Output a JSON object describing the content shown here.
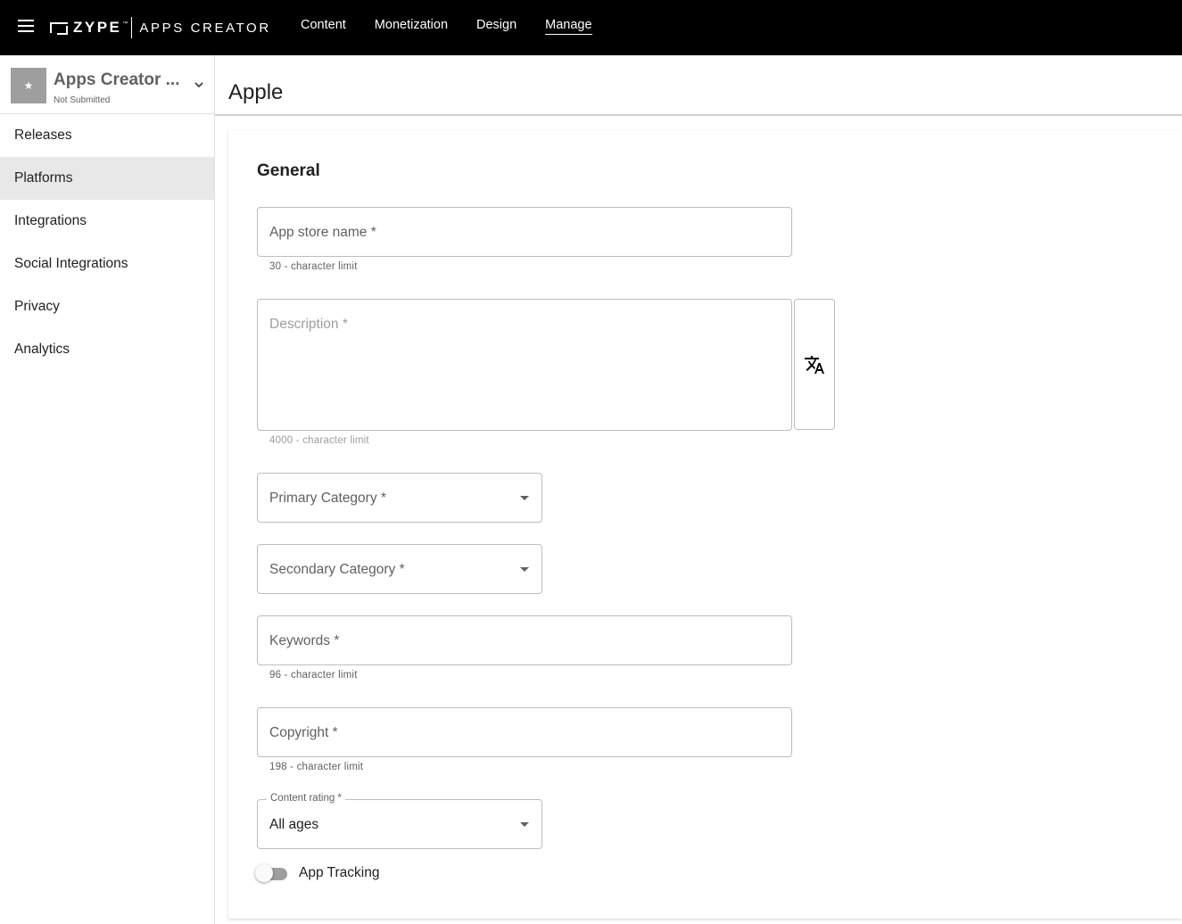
{
  "topbar": {
    "logo_brand": "ZYPE",
    "logo_tm": "™",
    "logo_product": "APPS CREATOR",
    "nav": [
      "Content",
      "Monetization",
      "Design",
      "Manage"
    ],
    "active_nav": "Manage"
  },
  "sidebar": {
    "app_name": "Apps Creator ...",
    "app_status": "Not Submitted",
    "app_thumb_glyph": "★",
    "items": [
      {
        "label": "Releases"
      },
      {
        "label": "Platforms"
      },
      {
        "label": "Integrations"
      },
      {
        "label": "Social Integrations"
      },
      {
        "label": "Privacy"
      },
      {
        "label": "Analytics"
      }
    ],
    "active_item": "Platforms"
  },
  "page": {
    "title": "Apple",
    "section_title": "General"
  },
  "form": {
    "app_store_name": {
      "placeholder": "App store name *",
      "hint": "30 - character limit"
    },
    "description": {
      "placeholder": "Description *",
      "hint": "4000 - character limit"
    },
    "primary_category": {
      "placeholder": "Primary Category *"
    },
    "secondary_category": {
      "placeholder": "Secondary Category *"
    },
    "keywords": {
      "placeholder": "Keywords *",
      "hint": "96 - character limit"
    },
    "copyright": {
      "placeholder": "Copyright *",
      "hint": "198 - character limit"
    },
    "content_rating": {
      "label": "Content rating *",
      "value": "All ages"
    },
    "app_tracking": {
      "label": "App Tracking",
      "enabled": false
    }
  },
  "icons": {
    "menu": "hamburger-menu-icon",
    "chevron": "chevron-down-icon",
    "translate": "translate-icon",
    "dropdown": "dropdown-arrow-icon"
  }
}
